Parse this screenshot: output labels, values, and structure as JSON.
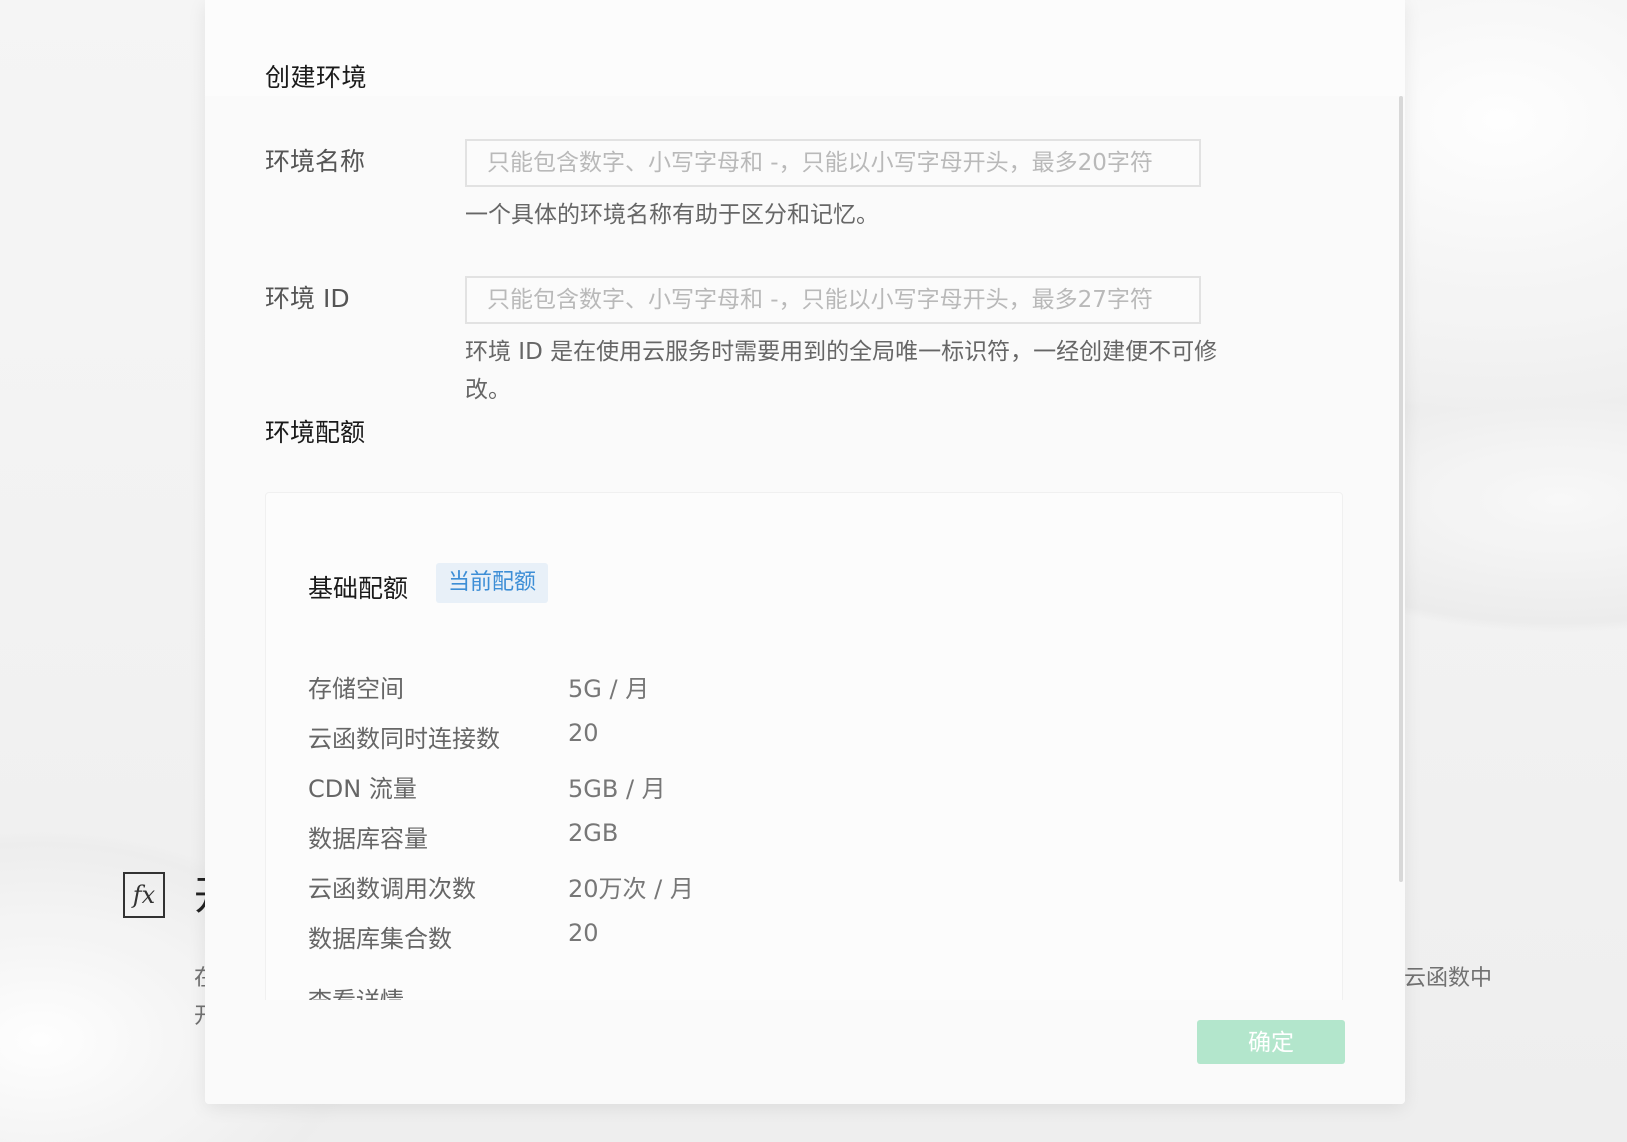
{
  "background": {
    "fx_icon_text": "fx",
    "title_fragment": "开",
    "left_text_lines": [
      "在",
      "开"
    ],
    "right_text": "云函数中"
  },
  "modal": {
    "title": "创建环境",
    "env_name": {
      "label": "环境名称",
      "placeholder": "只能包含数字、小写字母和 -，只能以小写字母开头，最多20字符",
      "hint": "一个具体的环境名称有助于区分和记忆。"
    },
    "env_id": {
      "label": "环境 ID",
      "placeholder": "只能包含数字、小写字母和 -，只能以小写字母开头，最多27字符",
      "hint": "环境 ID 是在使用云服务时需要用到的全局唯一标识符，一经创建便不可修改。"
    },
    "quota_section_title": "环境配额",
    "quota": {
      "name": "基础配额",
      "badge": "当前配额",
      "rows": [
        {
          "key": "存储空间",
          "value": "5G / 月"
        },
        {
          "key": "云函数同时连接数",
          "value": "20"
        },
        {
          "key": "CDN 流量",
          "value": "5GB / 月"
        },
        {
          "key": "数据库容量",
          "value": "2GB"
        },
        {
          "key": "云函数调用次数",
          "value": "20万次 / 月"
        },
        {
          "key": "数据库集合数",
          "value": "20"
        }
      ],
      "partial_next_label": "查看详情"
    },
    "confirm_label": "确定"
  },
  "colors": {
    "accent_blue": "#3d8ed6",
    "confirm_green_disabled": "#b3e6cc"
  }
}
